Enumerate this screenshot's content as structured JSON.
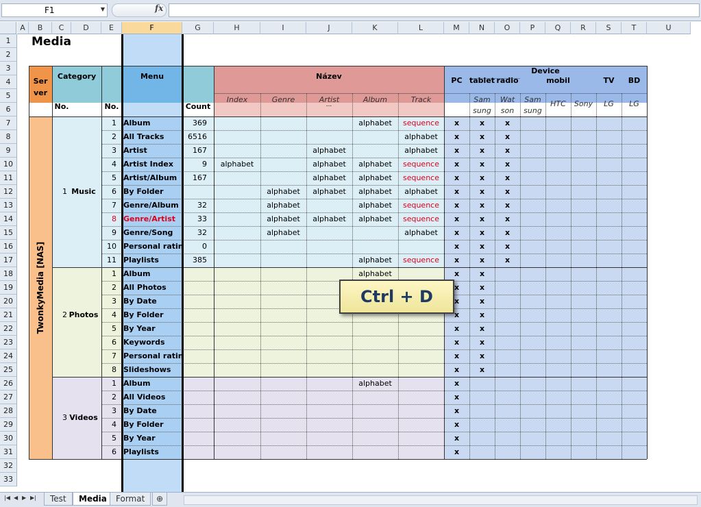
{
  "namebox": "F1",
  "fx_label": "fx",
  "columns": [
    "A",
    "B",
    "C",
    "D",
    "E",
    "F",
    "G",
    "H",
    "I",
    "J",
    "K",
    "L",
    "M",
    "N",
    "O",
    "P",
    "Q",
    "R",
    "S",
    "T",
    "U"
  ],
  "selected_column": "F",
  "rows": [
    "1",
    "2",
    "3",
    "4",
    "5",
    "6",
    "7",
    "8",
    "9",
    "10",
    "11",
    "12",
    "13",
    "14",
    "15",
    "16",
    "17",
    "18",
    "19",
    "20",
    "21",
    "22",
    "23",
    "24",
    "25",
    "26",
    "27",
    "28",
    "29",
    "30",
    "31",
    "32",
    "33"
  ],
  "title": "Media",
  "headers": {
    "server": "Ser\nver",
    "category": "Category",
    "cat_no": "No.",
    "no": "No.",
    "menu": "Menu",
    "count": "Count",
    "nazov": "Název",
    "ellipsis": "...",
    "device": "Device",
    "pc": "PC",
    "tablet": "tablet",
    "radio": "radio",
    "mobil": "mobil",
    "tv": "TV",
    "bd": "BD"
  },
  "sub_headers": [
    "Index",
    "Genre",
    "Artist",
    "Album",
    "Track"
  ],
  "device_sub": [
    "Sam\nsung",
    "Wat\nson",
    "Sam\nsung",
    "HTC",
    "Sony",
    "LG",
    "LG"
  ],
  "server_label": "TwonkyMedia [NAS]",
  "categories": [
    {
      "no": "1",
      "name": "Music"
    },
    {
      "no": "2",
      "name": "Photos"
    },
    {
      "no": "3",
      "name": "Videos"
    }
  ],
  "table": [
    {
      "no": "1",
      "menu": "Album",
      "count": "369",
      "index": "",
      "genre": "",
      "artist": "",
      "album": "alphabet",
      "track": "sequence",
      "pc": "x",
      "tab": "x",
      "radio": "x"
    },
    {
      "no": "2",
      "menu": "All Tracks",
      "count": "6516",
      "index": "",
      "genre": "",
      "artist": "",
      "album": "",
      "track": "alphabet",
      "pc": "x",
      "tab": "x",
      "radio": "x"
    },
    {
      "no": "3",
      "menu": "Artist",
      "count": "167",
      "index": "",
      "genre": "",
      "artist": "alphabet",
      "album": "",
      "track": "alphabet",
      "pc": "x",
      "tab": "x",
      "radio": "x"
    },
    {
      "no": "4",
      "menu": "Artist Index",
      "count": "9",
      "index": "alphabet",
      "genre": "",
      "artist": "alphabet",
      "album": "alphabet",
      "track": "sequence",
      "pc": "x",
      "tab": "x",
      "radio": "x"
    },
    {
      "no": "5",
      "menu": "Artist/Album",
      "count": "167",
      "index": "",
      "genre": "",
      "artist": "alphabet",
      "album": "alphabet",
      "track": "sequence",
      "pc": "x",
      "tab": "x",
      "radio": "x"
    },
    {
      "no": "6",
      "menu": "By Folder",
      "count": "",
      "index": "",
      "genre": "alphabet",
      "artist": "alphabet",
      "album": "alphabet",
      "track": "alphabet",
      "pc": "x",
      "tab": "x",
      "radio": "x"
    },
    {
      "no": "7",
      "menu": "Genre/Album",
      "count": "32",
      "index": "",
      "genre": "alphabet",
      "artist": "",
      "album": "alphabet",
      "track": "sequence",
      "pc": "x",
      "tab": "x",
      "radio": "x"
    },
    {
      "no": "8",
      "menu": "Genre/Artist",
      "count": "33",
      "index": "",
      "genre": "alphabet",
      "artist": "alphabet",
      "album": "alphabet",
      "track": "sequence",
      "pc": "x",
      "tab": "x",
      "radio": "x",
      "red": true
    },
    {
      "no": "9",
      "menu": "Genre/Song",
      "count": "32",
      "index": "",
      "genre": "alphabet",
      "artist": "",
      "album": "",
      "track": "alphabet",
      "pc": "x",
      "tab": "x",
      "radio": "x"
    },
    {
      "no": "10",
      "menu": "Personal rating",
      "count": "0",
      "index": "",
      "genre": "",
      "artist": "",
      "album": "",
      "track": "",
      "pc": "x",
      "tab": "x",
      "radio": "x"
    },
    {
      "no": "11",
      "menu": "Playlists",
      "count": "385",
      "index": "",
      "genre": "",
      "artist": "",
      "album": "alphabet",
      "track": "sequence",
      "pc": "x",
      "tab": "x",
      "radio": "x"
    },
    {
      "no": "1",
      "menu": "Album",
      "count": "",
      "index": "",
      "genre": "",
      "artist": "",
      "album": "alphabet",
      "track": "",
      "pc": "x",
      "tab": "x",
      "radio": ""
    },
    {
      "no": "2",
      "menu": "All Photos",
      "count": "",
      "index": "",
      "genre": "",
      "artist": "",
      "album": "",
      "track": "",
      "pc": "x",
      "tab": "x",
      "radio": ""
    },
    {
      "no": "3",
      "menu": "By Date",
      "count": "",
      "index": "",
      "genre": "",
      "artist": "",
      "album": "",
      "track": "",
      "pc": "x",
      "tab": "x",
      "radio": ""
    },
    {
      "no": "4",
      "menu": "By Folder",
      "count": "",
      "index": "",
      "genre": "",
      "artist": "",
      "album": "",
      "track": "",
      "pc": "x",
      "tab": "x",
      "radio": ""
    },
    {
      "no": "5",
      "menu": "By Year",
      "count": "",
      "index": "",
      "genre": "",
      "artist": "",
      "album": "",
      "track": "",
      "pc": "x",
      "tab": "x",
      "radio": ""
    },
    {
      "no": "6",
      "menu": "Keywords",
      "count": "",
      "index": "",
      "genre": "",
      "artist": "",
      "album": "",
      "track": "",
      "pc": "x",
      "tab": "x",
      "radio": ""
    },
    {
      "no": "7",
      "menu": "Personal rating",
      "count": "",
      "index": "",
      "genre": "",
      "artist": "",
      "album": "",
      "track": "",
      "pc": "x",
      "tab": "x",
      "radio": ""
    },
    {
      "no": "8",
      "menu": "Slideshows",
      "count": "",
      "index": "",
      "genre": "",
      "artist": "",
      "album": "",
      "track": "",
      "pc": "x",
      "tab": "x",
      "radio": ""
    },
    {
      "no": "1",
      "menu": "Album",
      "count": "",
      "index": "",
      "genre": "",
      "artist": "",
      "album": "alphabet",
      "track": "",
      "pc": "x",
      "tab": "",
      "radio": ""
    },
    {
      "no": "2",
      "menu": "All Videos",
      "count": "",
      "index": "",
      "genre": "",
      "artist": "",
      "album": "",
      "track": "",
      "pc": "x",
      "tab": "",
      "radio": ""
    },
    {
      "no": "3",
      "menu": "By Date",
      "count": "",
      "index": "",
      "genre": "",
      "artist": "",
      "album": "",
      "track": "",
      "pc": "x",
      "tab": "",
      "radio": ""
    },
    {
      "no": "4",
      "menu": "By Folder",
      "count": "",
      "index": "",
      "genre": "",
      "artist": "",
      "album": "",
      "track": "",
      "pc": "x",
      "tab": "",
      "radio": ""
    },
    {
      "no": "5",
      "menu": "By Year",
      "count": "",
      "index": "",
      "genre": "",
      "artist": "",
      "album": "",
      "track": "",
      "pc": "x",
      "tab": "",
      "radio": ""
    },
    {
      "no": "6",
      "menu": "Playlists",
      "count": "",
      "index": "",
      "genre": "",
      "artist": "",
      "album": "",
      "track": "",
      "pc": "x",
      "tab": "",
      "radio": ""
    }
  ],
  "tooltip": "Ctrl + D",
  "tabs": [
    "Test",
    "Media",
    "Format"
  ],
  "active_tab": "Media",
  "colors": {
    "server": "#f0944a",
    "server_body": "#f9c08c",
    "nazov": "#df9a98",
    "nazov_body": "#f2c8c4",
    "device": "#9ab9e8",
    "menu": "#b6d6f6",
    "music": "#dceef6",
    "photos": "#eef3de",
    "videos": "#e5e1ef",
    "device_body": "#cad9f2",
    "red": "#e0001a"
  }
}
